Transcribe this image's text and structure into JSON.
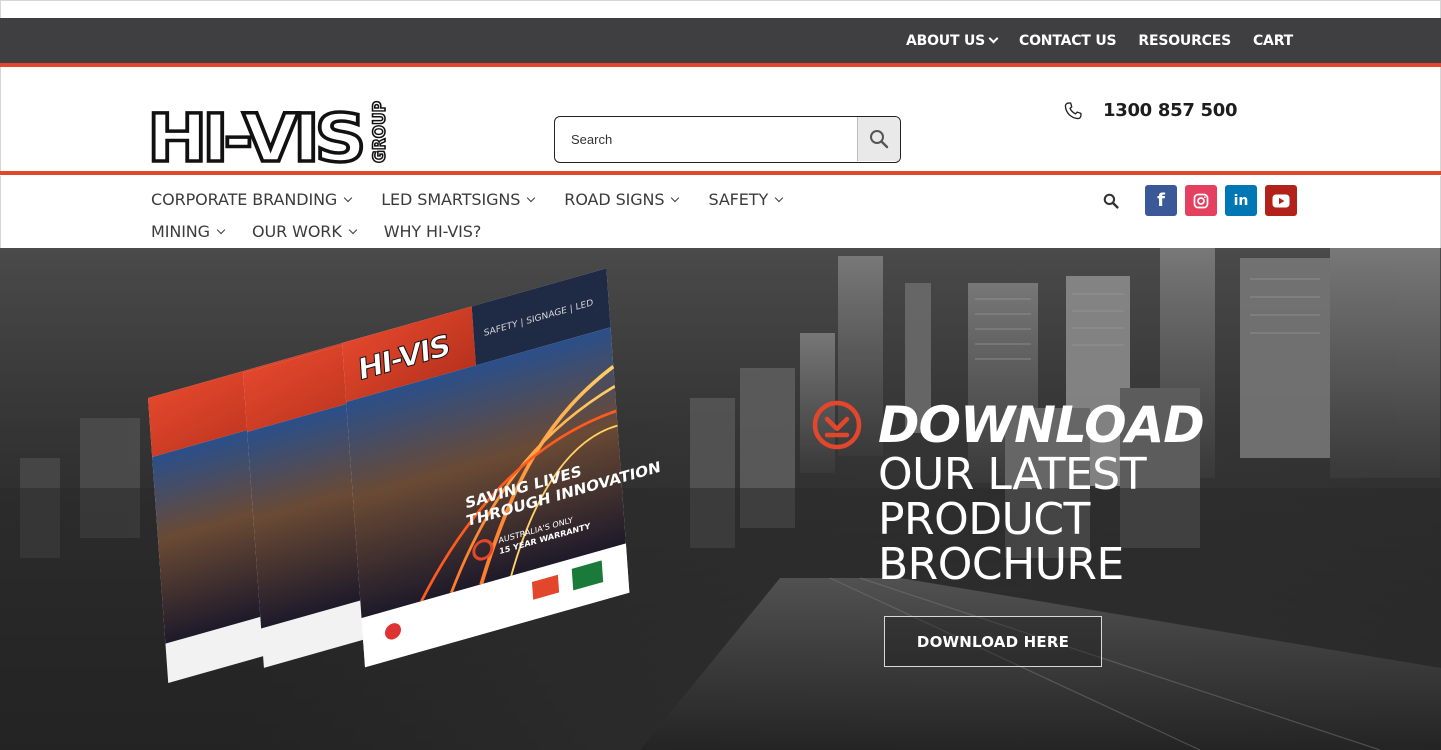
{
  "topbar": {
    "items": [
      {
        "label": "ABOUT US",
        "dropdown": true
      },
      {
        "label": "CONTACT US",
        "dropdown": false
      },
      {
        "label": "RESOURCES",
        "dropdown": false
      },
      {
        "label": "CART",
        "dropdown": false
      }
    ]
  },
  "header": {
    "logo_text": "HI-VIS",
    "logo_sub": "GROUP",
    "search_placeholder": "Search",
    "phone": "1300 857 500"
  },
  "nav": {
    "row1": [
      {
        "label": "CORPORATE BRANDING",
        "dropdown": true
      },
      {
        "label": "LED SMARTSIGNS",
        "dropdown": true
      },
      {
        "label": "ROAD SIGNS",
        "dropdown": true
      },
      {
        "label": "SAFETY",
        "dropdown": true
      }
    ],
    "row2": [
      {
        "label": "MINING",
        "dropdown": true
      },
      {
        "label": "OUR WORK",
        "dropdown": true
      },
      {
        "label": "WHY HI-VIS?",
        "dropdown": false
      }
    ]
  },
  "social": [
    {
      "name": "facebook-icon",
      "glyph": "f",
      "color": "#3b5998"
    },
    {
      "name": "instagram-icon",
      "glyph": "◎",
      "color": "#e4405f"
    },
    {
      "name": "linkedin-icon",
      "glyph": "in",
      "color": "#0077b5"
    },
    {
      "name": "youtube-icon",
      "glyph": "▶",
      "color": "#b2221a"
    }
  ],
  "hero": {
    "title": "DOWNLOAD",
    "subtitle_lines": [
      "OUR LATEST",
      "PRODUCT",
      "BROCHURE"
    ],
    "button_label": "DOWNLOAD HERE",
    "brochure": {
      "logo_text": "HI-VIS",
      "tagline": "SAFETY | SIGNAGE | LED",
      "headline_1": "SAVING LIVES",
      "headline_2": "THROUGH INNOVATION",
      "warranty_1": "AUSTRALIA'S ONLY",
      "warranty_2": "15 YEAR WARRANTY"
    }
  },
  "colors": {
    "accent": "#e2472c",
    "topbar": "#3f3f41"
  }
}
